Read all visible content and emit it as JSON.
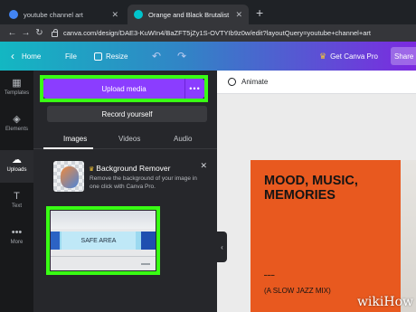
{
  "browser": {
    "tabs": [
      {
        "title": "youtube channel art",
        "active": false
      },
      {
        "title": "Orange and Black Brutalist Swiss",
        "active": true
      }
    ],
    "url": "canva.com/design/DAE3-KuWIn4/BaZFT5jZy1S-OVTYIb9z0w/edit?layoutQuery=youtube+channel+art"
  },
  "topbar": {
    "home": "Home",
    "file": "File",
    "resize": "Resize",
    "get_pro": "Get Canva Pro",
    "share": "Share"
  },
  "rail": {
    "items": [
      {
        "label": "Templates",
        "icon": "templates-icon"
      },
      {
        "label": "Elements",
        "icon": "elements-icon"
      },
      {
        "label": "Uploads",
        "icon": "upload-cloud-icon"
      },
      {
        "label": "Text",
        "icon": "text-icon"
      },
      {
        "label": "More",
        "icon": "more-dots-icon"
      }
    ],
    "active": "Uploads"
  },
  "panel": {
    "upload_media": "Upload media",
    "more": "•••",
    "record_yourself": "Record yourself",
    "tabs": [
      "Images",
      "Videos",
      "Audio"
    ],
    "active_tab": "Images",
    "bg_remover": {
      "title": "Background Remover",
      "description": "Remove the background of your image in one click with Canva Pro."
    },
    "upload_thumb_label": "SAFE AREA",
    "highlight_color": "#39ff14"
  },
  "editor": {
    "animate": "Animate"
  },
  "design": {
    "headline": "MOOD, MUSIC, MEMORIES",
    "subtitle": "(A SLOW JAZZ MIX)",
    "background": "#e8591f"
  },
  "watermark": "wikiHow"
}
